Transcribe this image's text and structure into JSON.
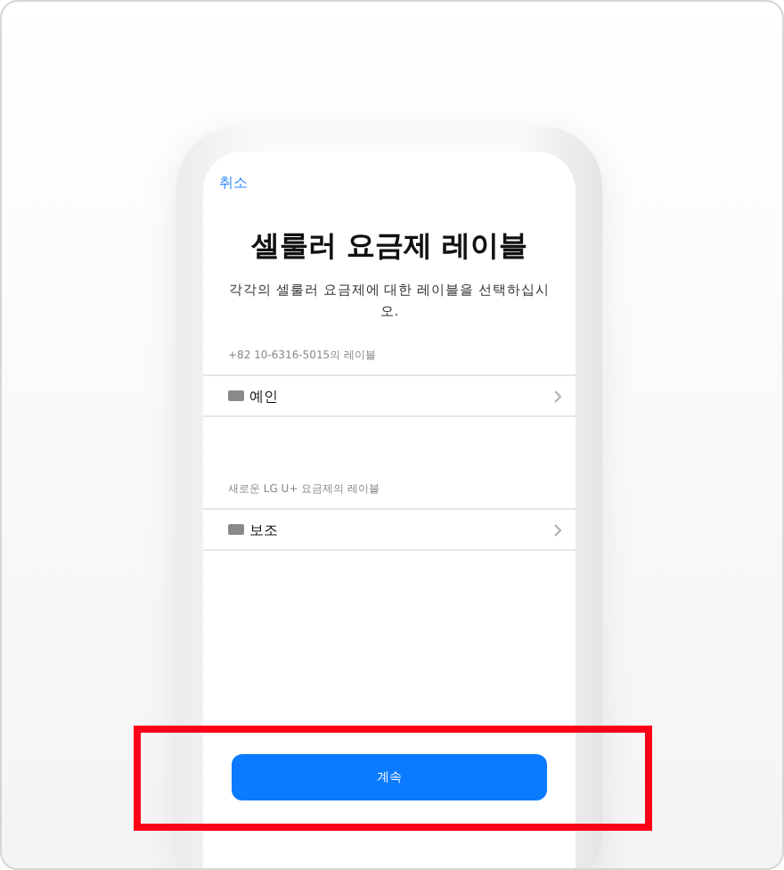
{
  "cancel": "취소",
  "title": "셀룰러 요금제 레이블",
  "subtitle": "각각의 셀룰러 요금제에 대한 레이블을 선택하십시오.",
  "sections": [
    {
      "label": "+82 10-6316-5015의 레이블",
      "item": "예인"
    },
    {
      "label": "새로운 LG U+ 요금제의 레이블",
      "item": "보조"
    }
  ],
  "button": "계속",
  "highlight": {
    "on": true
  }
}
